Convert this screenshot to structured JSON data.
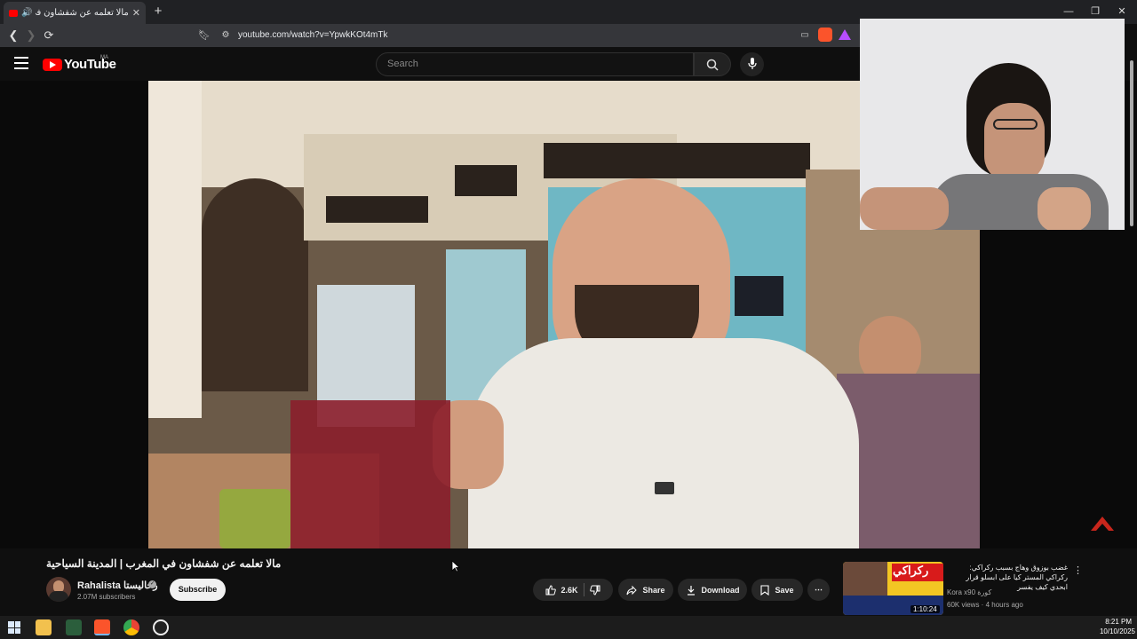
{
  "browser": {
    "tab_title": "مالا تعلمه عن شفشاون في الـ",
    "tab_close": "✕",
    "new_tab": "+",
    "url": "youtube.com/watch?v=YpwkKOt4mTk",
    "window_controls": {
      "minimize": "—",
      "restore": "❐",
      "close": "✕"
    },
    "nav": {
      "back": "❮",
      "forward": "❯",
      "reload": "⟳"
    }
  },
  "youtube": {
    "logo_text": "YouTube",
    "region": "MA",
    "search_placeholder": "Search",
    "search_icon": "⌕",
    "mic_icon": "🎤"
  },
  "video": {
    "title": "مالا تعلمه عن شفشاون في المغرب | المدينة السياحية",
    "channel_name": "Rahalista رحاليستا",
    "subscribers": "2.07M subscribers",
    "subscribe_label": "Subscribe",
    "like_count": "2.6K",
    "share_label": "Share",
    "download_label": "Download",
    "save_label": "Save",
    "more_label": "⋯"
  },
  "recommended": {
    "title": "غضب بوزوق وهاج بسبب ركراكي: ركراكي المستر كيا على ابسلو قرار ابحدي كيف يفسر",
    "channel": "Kora x90 كورة",
    "meta": "60K views · 4 hours ago",
    "duration": "1:10:24",
    "thumb_text": "ركراكي"
  },
  "taskbar": {
    "time": "8:21 PM",
    "date": "10/10/2025"
  },
  "colors": {
    "brand_red": "#ff0000",
    "background": "#0f0f0f",
    "pill": "#272727"
  }
}
